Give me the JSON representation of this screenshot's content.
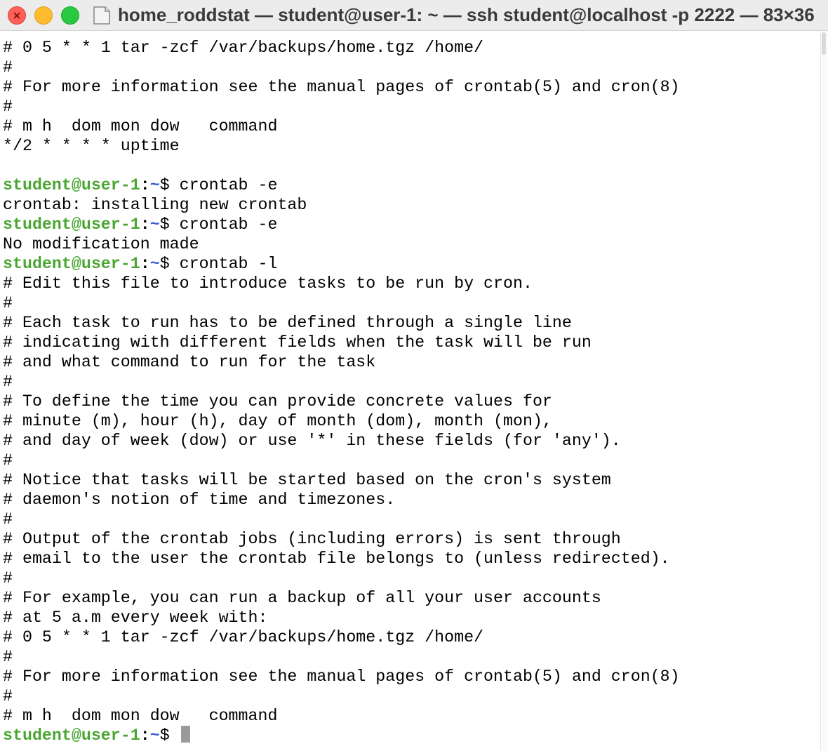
{
  "window": {
    "title": "home_roddstat — student@user-1: ~ — ssh student@localhost -p 2222 — 83×36",
    "close_glyph": "×",
    "title_icon": "folder-icon"
  },
  "terminal": {
    "lines": [
      {
        "kind": "text",
        "text": "# 0 5 * * 1 tar -zcf /var/backups/home.tgz /home/"
      },
      {
        "kind": "text",
        "text": "#"
      },
      {
        "kind": "text",
        "text": "# For more information see the manual pages of crontab(5) and cron(8)"
      },
      {
        "kind": "text",
        "text": "#"
      },
      {
        "kind": "text",
        "text": "# m h  dom mon dow   command"
      },
      {
        "kind": "text",
        "text": "*/2 * * * * uptime"
      },
      {
        "kind": "text",
        "text": ""
      },
      {
        "kind": "prompt",
        "user": "student@user-1",
        "colon": ":",
        "path": "~",
        "dollar": "$",
        "cmd": " crontab -e"
      },
      {
        "kind": "text",
        "text": "crontab: installing new crontab"
      },
      {
        "kind": "prompt",
        "user": "student@user-1",
        "colon": ":",
        "path": "~",
        "dollar": "$",
        "cmd": " crontab -e"
      },
      {
        "kind": "text",
        "text": "No modification made"
      },
      {
        "kind": "prompt",
        "user": "student@user-1",
        "colon": ":",
        "path": "~",
        "dollar": "$",
        "cmd": " crontab -l"
      },
      {
        "kind": "text",
        "text": "# Edit this file to introduce tasks to be run by cron."
      },
      {
        "kind": "text",
        "text": "#"
      },
      {
        "kind": "text",
        "text": "# Each task to run has to be defined through a single line"
      },
      {
        "kind": "text",
        "text": "# indicating with different fields when the task will be run"
      },
      {
        "kind": "text",
        "text": "# and what command to run for the task"
      },
      {
        "kind": "text",
        "text": "#"
      },
      {
        "kind": "text",
        "text": "# To define the time you can provide concrete values for"
      },
      {
        "kind": "text",
        "text": "# minute (m), hour (h), day of month (dom), month (mon),"
      },
      {
        "kind": "text",
        "text": "# and day of week (dow) or use '*' in these fields (for 'any')."
      },
      {
        "kind": "text",
        "text": "#"
      },
      {
        "kind": "text",
        "text": "# Notice that tasks will be started based on the cron's system"
      },
      {
        "kind": "text",
        "text": "# daemon's notion of time and timezones."
      },
      {
        "kind": "text",
        "text": "#"
      },
      {
        "kind": "text",
        "text": "# Output of the crontab jobs (including errors) is sent through"
      },
      {
        "kind": "text",
        "text": "# email to the user the crontab file belongs to (unless redirected)."
      },
      {
        "kind": "text",
        "text": "#"
      },
      {
        "kind": "text",
        "text": "# For example, you can run a backup of all your user accounts"
      },
      {
        "kind": "text",
        "text": "# at 5 a.m every week with:"
      },
      {
        "kind": "text",
        "text": "# 0 5 * * 1 tar -zcf /var/backups/home.tgz /home/"
      },
      {
        "kind": "text",
        "text": "#"
      },
      {
        "kind": "text",
        "text": "# For more information see the manual pages of crontab(5) and cron(8)"
      },
      {
        "kind": "text",
        "text": "#"
      },
      {
        "kind": "text",
        "text": "# m h  dom mon dow   command"
      },
      {
        "kind": "prompt",
        "user": "student@user-1",
        "colon": ":",
        "path": "~",
        "dollar": "$",
        "cmd": " ",
        "cursor": true
      }
    ]
  },
  "colors": {
    "prompt_user": "#4aa631",
    "prompt_path": "#3b5cd6",
    "cursor": "#9a9a9a"
  }
}
